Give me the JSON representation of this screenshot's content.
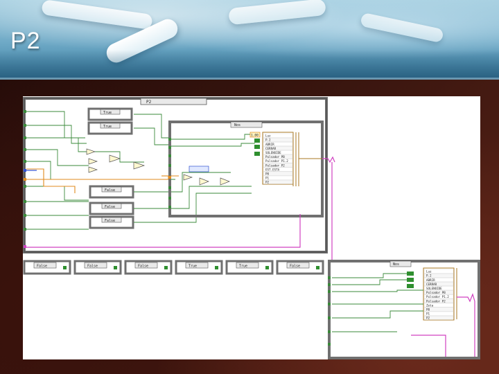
{
  "slide": {
    "title": "P2"
  },
  "diagram": {
    "case_labels": [
      "True",
      "True",
      "False",
      "False",
      "False"
    ],
    "top_case_selector": "P2",
    "inner_case_selector": "Nos",
    "bottom_case_selector": "Nos",
    "dial_number": "1.00",
    "bottom_cases": [
      "False",
      "False",
      "False",
      "True",
      "True",
      "False"
    ],
    "cluster_fields_top": [
      "Luz",
      "P.2",
      "ABRIR",
      "CERRAR",
      "SOLENOIDE",
      "Pulsador PB",
      "Pulsador P1.2",
      "Pulsador P2",
      "EST.ESTA",
      "P0",
      "P1",
      "P2"
    ],
    "cluster_fields_bottom": [
      "Luz",
      "P.2",
      "ABRIR",
      "CERRAR",
      "SOLENOIDE",
      "Pulsador PB",
      "Pulsador P1.2",
      "Pulsador P2",
      "Zeta",
      "P0",
      "P1",
      "P2"
    ],
    "colors": {
      "wire_orange": "#e08a1c",
      "wire_green": "#3a8a3a",
      "wire_pink": "#d040c0",
      "wire_blue": "#3050d0",
      "frame": "#707070"
    }
  }
}
